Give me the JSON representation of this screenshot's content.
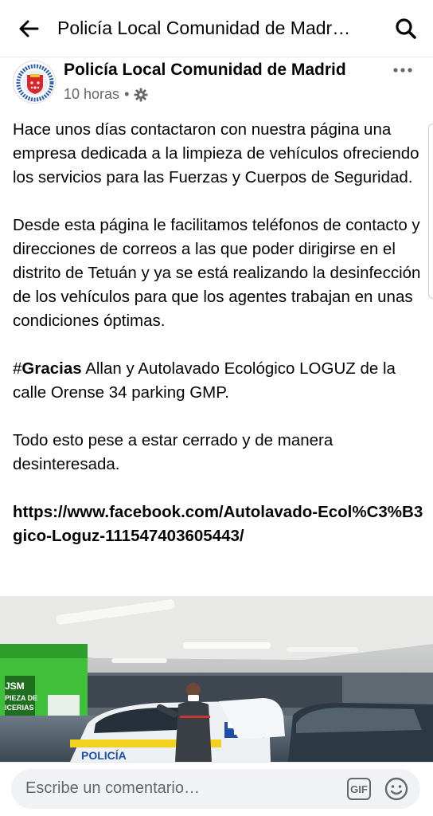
{
  "header": {
    "title": "Policía Local Comunidad de Madr…",
    "back_icon": "back-arrow-icon",
    "search_icon": "search-icon"
  },
  "post": {
    "author": "Policía Local Comunidad de Madrid",
    "time": "10 horas",
    "separator": "•",
    "privacy_icon": "gear-icon",
    "more_icon": "more-dots-icon",
    "paragraphs": [
      "Hace unos días contactaron con nuestra página una empresa dedicada a la limpieza de vehículos ofreciendo los servicios para las Fuerzas y Cuerpos de Seguridad.",
      "Desde esta página le facilitamos teléfonos de contacto y direcciones de correos a las que poder dirigirse en el distrito de Tetuán y ya se está realizando la desinfección de los vehículos para que los agentes trabajan en unas condiciones óptimas."
    ],
    "thanks_hash": "#",
    "thanks_word": "Gracias",
    "thanks_rest": " Allan y  Autolavado Ecológico LOGUZ de la calle Orense 34 parking GMP.",
    "closing": "Todo esto pese a estar cerrado y de manera desinteresada.",
    "link": "https://www.facebook.com/Autolavado-Ecol%C3%B3gico-Loguz-111547403605443/",
    "photo_texts": {
      "car_label": "POLICÍA",
      "sign_line1": "JSM",
      "sign_line2": "PIEZA DE",
      "sign_line3": "ICERIAS"
    }
  },
  "comment": {
    "placeholder": "Escribe un comentario…",
    "gif_label": "GIF",
    "emoji_icon": "smiley-icon"
  },
  "colors": {
    "text": "#050505",
    "secondary": "#65676b",
    "comment_bg": "#f0f2f5",
    "wash_green": "#3fbf3a"
  }
}
